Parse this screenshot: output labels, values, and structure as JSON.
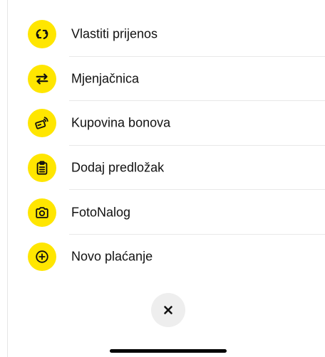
{
  "colors": {
    "accent": "#ffe600",
    "text": "#111111",
    "divider": "#e8e8e8",
    "close_bg": "#eeeeee"
  },
  "menu": {
    "items": [
      {
        "label": "Vlastiti prijenos",
        "icon": "refresh-transfer-icon"
      },
      {
        "label": "Mjenjačnica",
        "icon": "exchange-arrows-icon"
      },
      {
        "label": "Kupovina bonova",
        "icon": "card-contactless-icon"
      },
      {
        "label": "Dodaj predložak",
        "icon": "clipboard-icon"
      },
      {
        "label": "FotoNalog",
        "icon": "camera-icon"
      },
      {
        "label": "Novo plaćanje",
        "icon": "plus-circle-icon"
      }
    ]
  },
  "close": {
    "icon": "close-icon"
  }
}
